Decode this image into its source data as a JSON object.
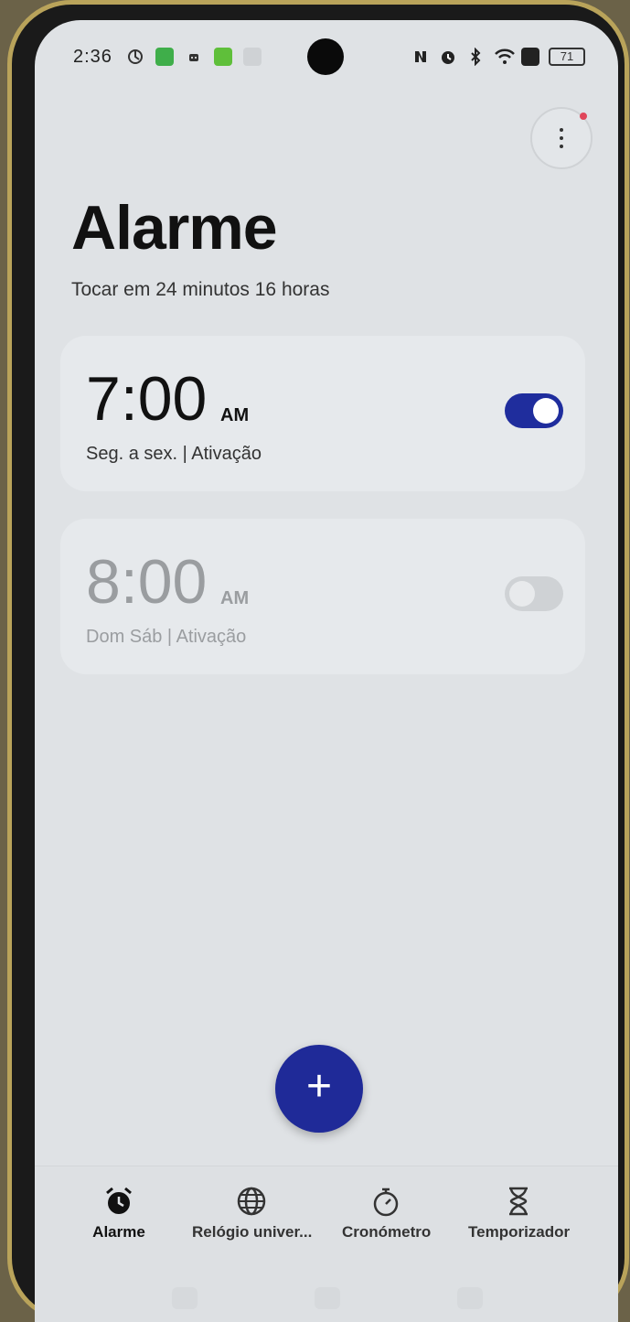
{
  "status_bar": {
    "time": "2:36",
    "battery": "71",
    "left_icons": [
      "sync-icon",
      "app-green-icon",
      "robot-icon",
      "app-green-icon",
      "app-grey-icon"
    ],
    "right_icons": [
      "nfc-icon",
      "alarm-icon",
      "bluetooth-icon",
      "wifi-icon",
      "sim-icon"
    ]
  },
  "header": {
    "title": "Alarme",
    "subtitle": "Tocar em 24 minutos 16 horas",
    "menu_icon": "more-vertical-icon"
  },
  "alarms": [
    {
      "time": "7:00",
      "ampm": "AM",
      "desc": "Seg. a sex. | Ativação",
      "enabled": true
    },
    {
      "time": "8:00",
      "ampm": "AM",
      "desc": "Dom Sáb | Ativação",
      "enabled": false
    }
  ],
  "fab": {
    "label": "+",
    "icon": "plus-icon"
  },
  "bottom_nav": [
    {
      "label": "Alarme",
      "icon": "alarm-clock-icon",
      "active": true
    },
    {
      "label": "Relógio univer...",
      "icon": "globe-icon",
      "active": false
    },
    {
      "label": "Cronómetro",
      "icon": "stopwatch-icon",
      "active": false
    },
    {
      "label": "Temporizador",
      "icon": "hourglass-icon",
      "active": false
    }
  ],
  "colors": {
    "accent": "#1f2a98",
    "background": "#dfe2e5",
    "card": "#e6e9ec",
    "notification": "#e0465a"
  }
}
